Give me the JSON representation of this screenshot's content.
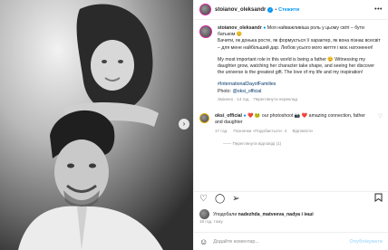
{
  "post": {
    "username": "stoianov_oleksandr",
    "separator": "•",
    "follow_label": "Стежити",
    "more_label": "•••",
    "carousel_next": "›"
  },
  "caption": {
    "username": "stoianov_oleksandr",
    "line1": "Моя найважливіша роль у цьому світі – бути батьком 😊",
    "line2": "Бачити, як донька росте, як формується її характер, як вона пізнає всесвіт – для мене найбільший дар. Любов усього мого життя і моє натхнення!",
    "line3": "My most important role in this world is being a father 😊 Witnessing my daughter grow, watching her character take shape, and seeing her discover the universe is the greatest gift. The love of my life and my inspiration!",
    "hashtag": "#InternationalDayofFamilies",
    "photo_label": "Photo:",
    "photo_credit": "@oksi_official",
    "edited": "Змінено · 14 год.",
    "see_translation": "Переглянути переклад"
  },
  "comment": {
    "username": "oksi_official",
    "text": "❤️ 🐸 our photoshoot 📷 ❤️ amazing connection, father and daughter",
    "time": "17 год.",
    "likes": "Позначки «Подобається»: 2",
    "reply": "Відповісти",
    "view_replies": "—— Переглянути відповіді (1)"
  },
  "actions": {
    "like_icon": "heart-icon",
    "comment_icon": "comment-icon",
    "share_icon": "share-icon",
    "save_icon": "bookmark-icon"
  },
  "likes": {
    "prefix": "Уподобали",
    "user": "nadezhda_matveeva_nadya",
    "suffix": "і інші"
  },
  "timestamp": "19 год. тому",
  "add_comment": {
    "placeholder": "Додайте коментар...",
    "publish": "Опублікувати"
  },
  "colors": {
    "accent": "#0095f6",
    "link": "#00376b",
    "muted": "#8e8e8e"
  }
}
